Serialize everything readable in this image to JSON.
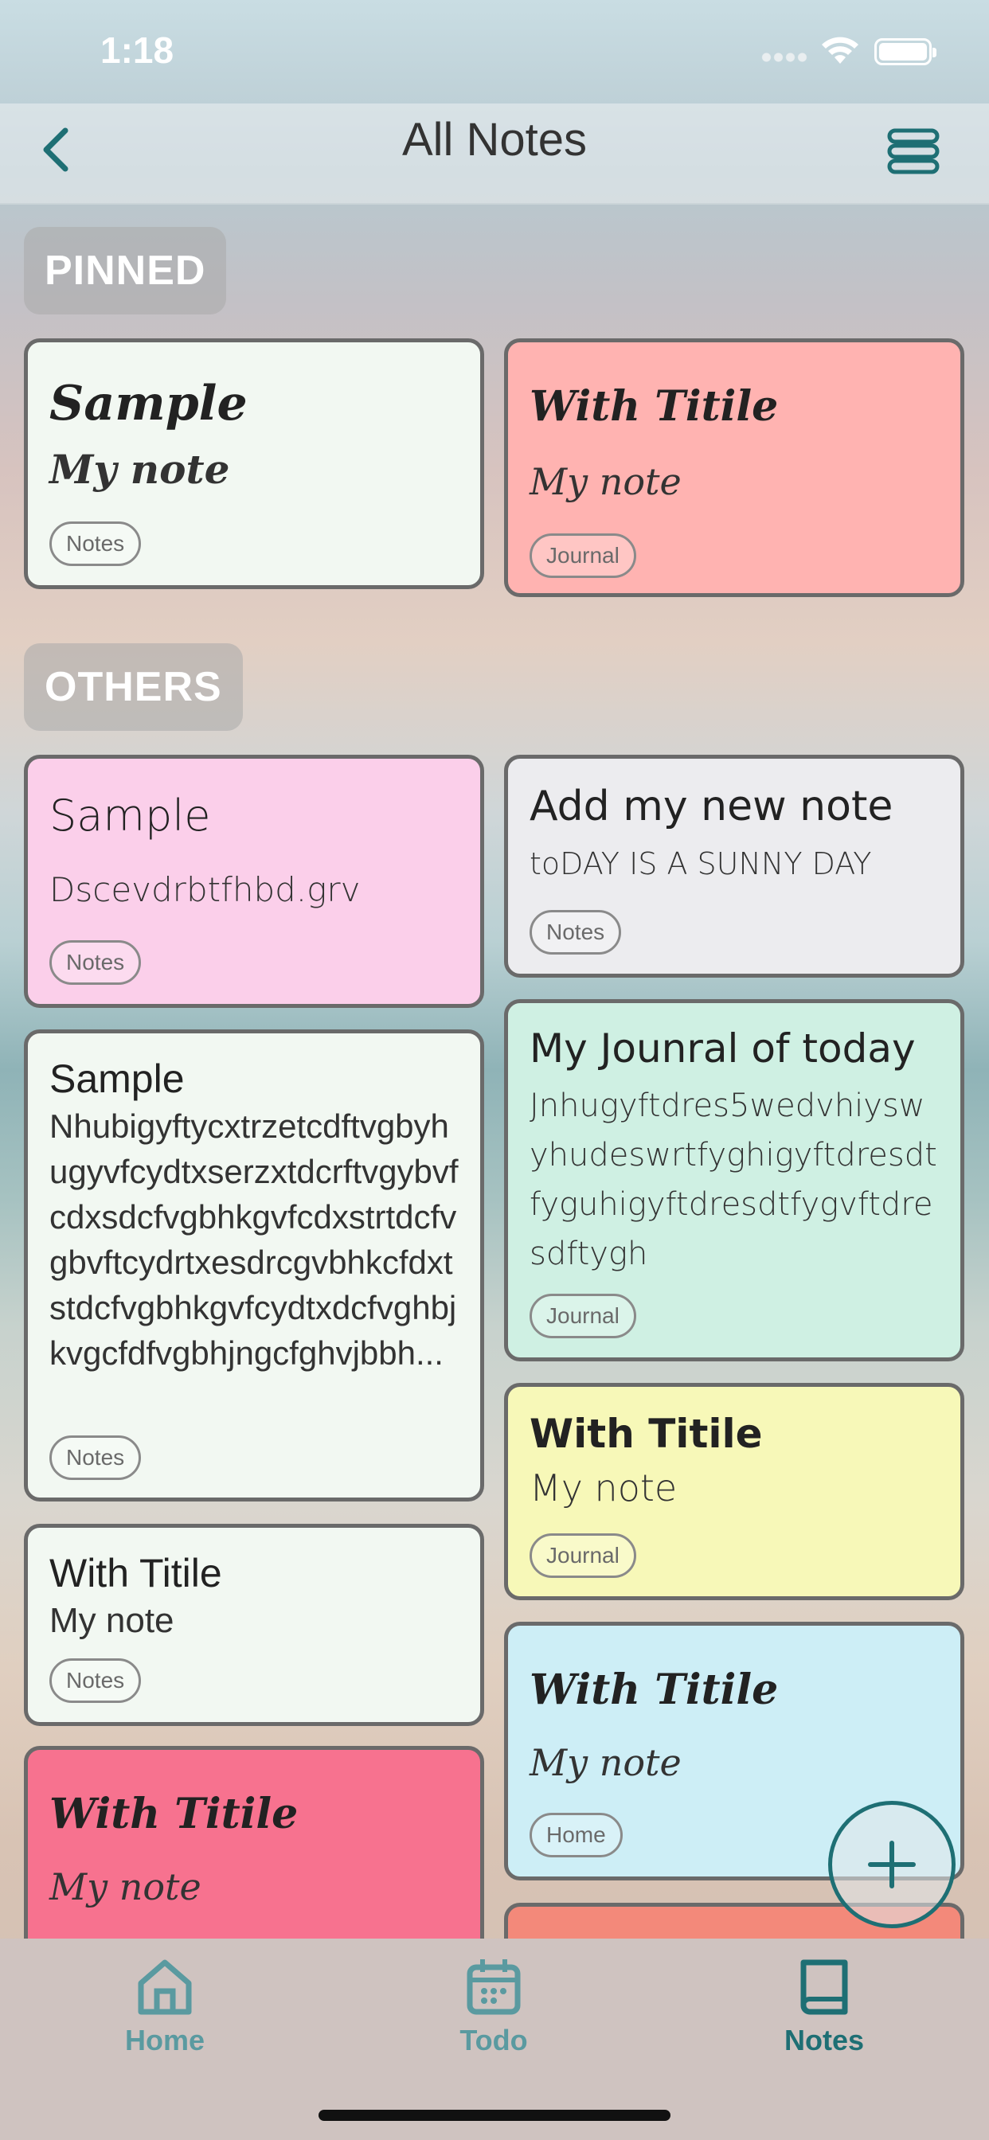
{
  "status": {
    "time": "1:18"
  },
  "header": {
    "title": "All Notes"
  },
  "sections": {
    "pinned": "PINNED",
    "others": "OTHERS"
  },
  "pinned": [
    {
      "title": "Sample",
      "body": "My note",
      "tag": "Notes",
      "color": "#f2f8f2"
    },
    {
      "title": "With Titile",
      "body": "My note",
      "tag": "Journal",
      "color": "#ffb3b1"
    }
  ],
  "others_left": [
    {
      "title": "Sample",
      "body": "Dscevdrbtfhbd.grv",
      "tag": "Notes",
      "color": "#fbcfea"
    },
    {
      "title": "Sample",
      "body": "Nhubigyftycxtrzetcdftvgbyhugyvfcydtxserzxtdcrftvgybvfcdxsdcfvgbhkgvfcdxstrtdcfvgbvftcydrtxesdrcgvbhkcfdxtstdcfvgbhkgvfcydtxdcfvghbjkvgcfdfvgbhjngcfghvjbbh...",
      "tag": "Notes",
      "color": "#f2f8f2"
    },
    {
      "title": "With Titile",
      "body": "My note",
      "tag": "Notes",
      "color": "#f2f8f2"
    },
    {
      "title": "With Titile",
      "body": "My note",
      "tag": "",
      "color": "#f7728f"
    }
  ],
  "others_right": [
    {
      "title": "Add my new note",
      "body": "toDAY IS A SUNNY DAY",
      "tag": "Notes",
      "color": "#ececef"
    },
    {
      "title": "My Jounral of today",
      "body": "Jnhugyftdres5wedvhiyswyhudeswrtfyghigyftdresdtfyguhigyftdresdtfygvftdresdftygh",
      "tag": "Journal",
      "color": "#cff0e3"
    },
    {
      "title": "With Titile",
      "body": "My note",
      "tag": "Journal",
      "color": "#f7f8b8"
    },
    {
      "title": "With Titile",
      "body": "My note",
      "tag": "Home",
      "color": "#cdeef6"
    },
    {
      "title": "",
      "body": "",
      "tag": "",
      "color": "#f3897a"
    }
  ],
  "tabs": [
    {
      "label": "Home",
      "icon": "home-icon"
    },
    {
      "label": "Todo",
      "icon": "calendar-icon"
    },
    {
      "label": "Notes",
      "icon": "book-icon"
    }
  ],
  "colors": {
    "accent": "#1e6f74",
    "tab_inactive": "#5a9aa0"
  }
}
